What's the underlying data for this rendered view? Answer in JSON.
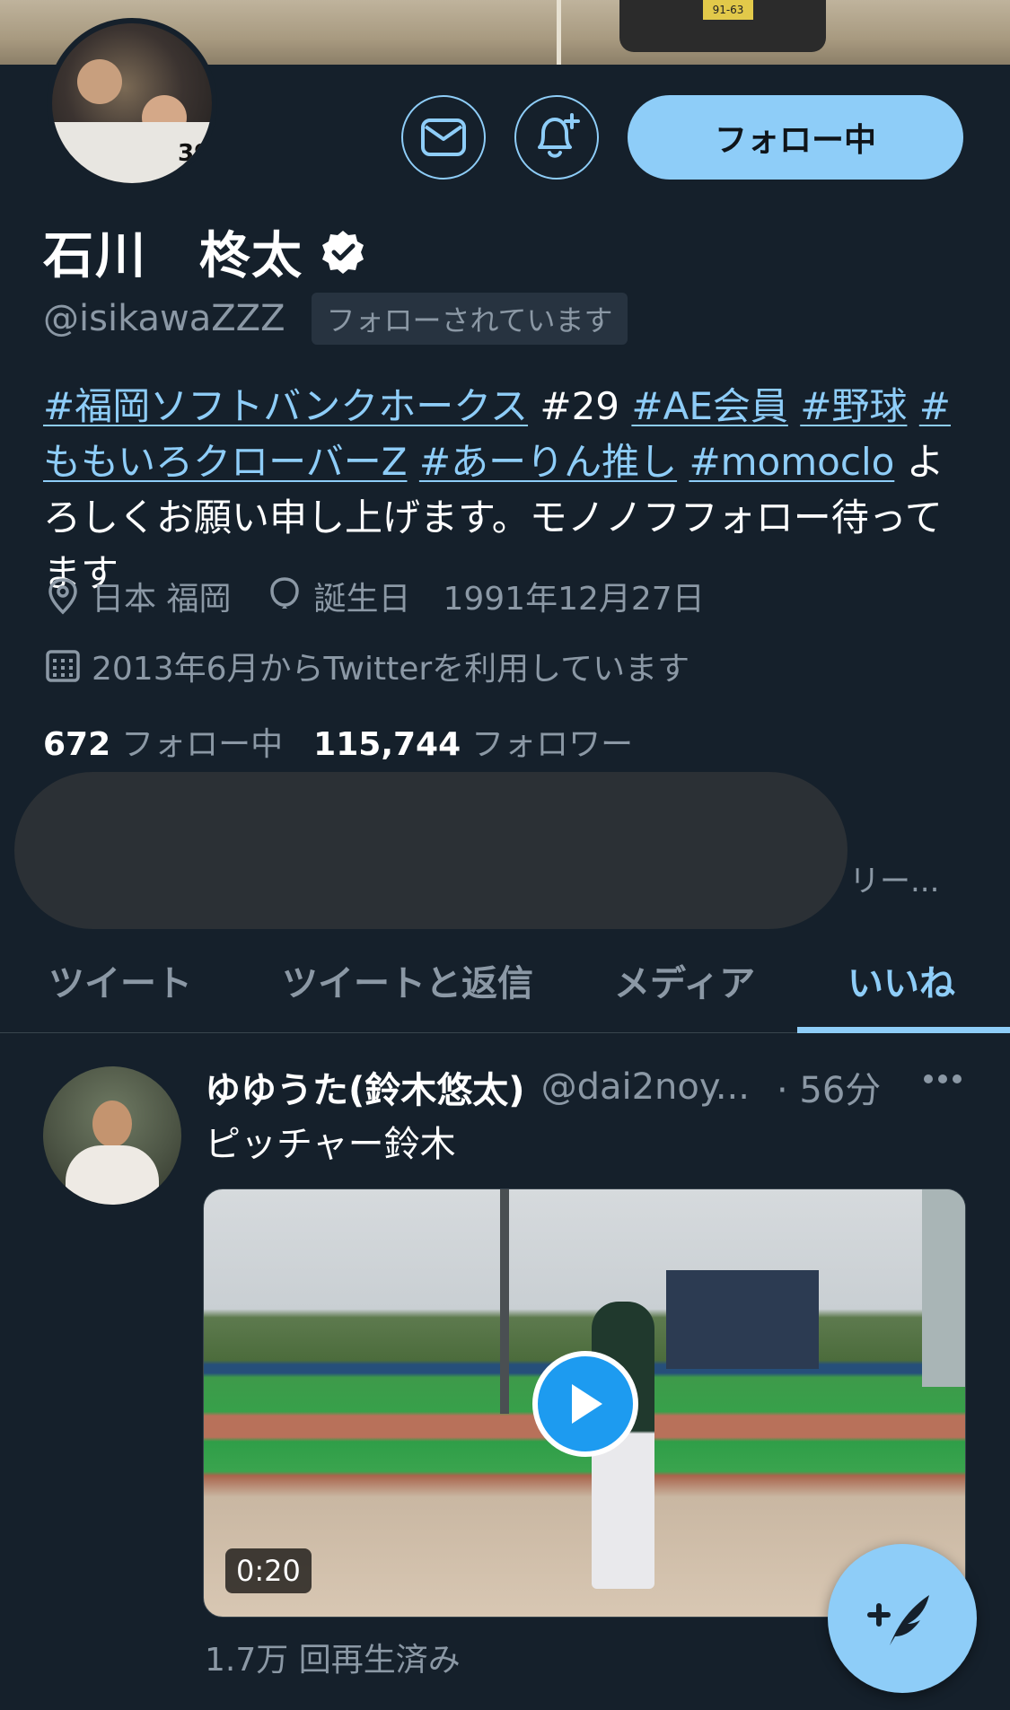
{
  "profile": {
    "follow_button_label": "フォロー中",
    "name": "石川　柊太",
    "handle": "@isikawaZZZ",
    "follows_you_badge": "フォローされています",
    "bio": {
      "tag1": "#福岡ソフトバンクホークス",
      "text1": " #29 ",
      "tag2": "#AE会員",
      "text2": " ",
      "tag3": "#野球",
      "text3": " ",
      "tag4": "#ももいろクローバーZ",
      "text4": " ",
      "tag5": "#あーりん推し",
      "text5": " ",
      "tag6": "#momoclo",
      "text6": " よろしくお願い申し上げます。モノノフフォロー待ってます"
    },
    "location": "日本 福岡",
    "birthday_label": "誕生日",
    "birthday": "1991年12月27日",
    "joined": "2013年6月からTwitterを利用しています",
    "following_count": "672",
    "following_label": "フォロー中",
    "followers_count": "115,744",
    "followers_label": "フォロワー",
    "overlay_trailing_text": "リー..."
  },
  "tabs": [
    {
      "label": "ツイート"
    },
    {
      "label": "ツイートと返信"
    },
    {
      "label": "メディア"
    },
    {
      "label": "いいね"
    }
  ],
  "active_tab": "いいね",
  "tweet": {
    "author_name": "ゆゆうた(鈴木悠太)",
    "author_handle": "@dai2noy...",
    "time": "· 56分",
    "text": "ピッチャー鈴木",
    "video_duration": "0:20",
    "views": "1.7万 回再生済み"
  },
  "colors": {
    "background": "#15202b",
    "accent": "#8ecdf8",
    "secondary_text": "#8b98a5",
    "link": "#8ecdf8"
  },
  "icons": {
    "message": "envelope-icon",
    "notify": "bell-plus-icon",
    "verified": "verified-badge-icon",
    "location": "location-pin-icon",
    "birthday": "balloon-icon",
    "joined": "calendar-icon",
    "more": "more-dots-icon",
    "play": "play-icon",
    "compose": "compose-tweet-icon"
  }
}
